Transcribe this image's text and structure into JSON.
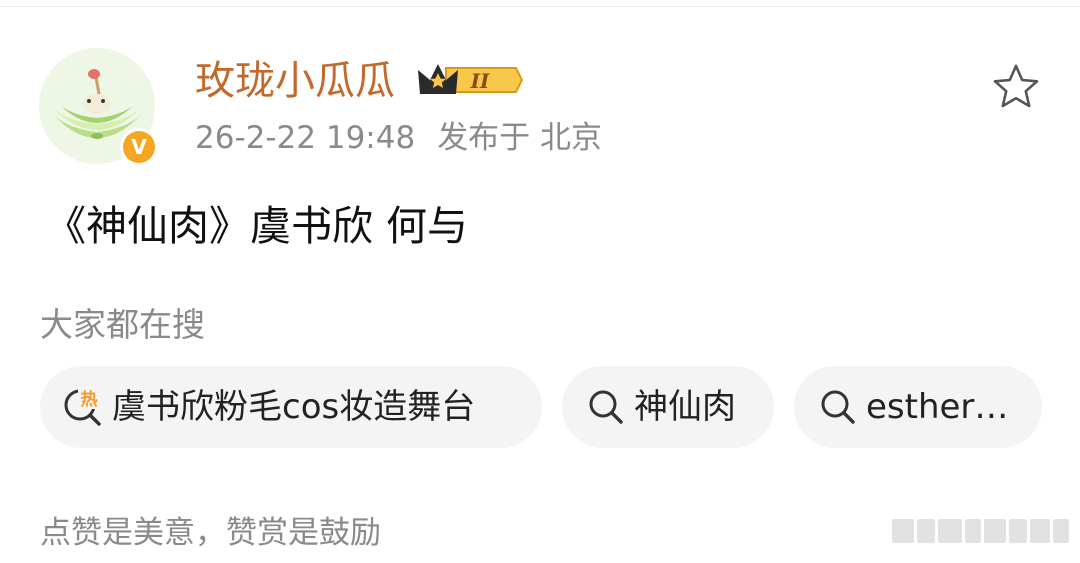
{
  "post": {
    "author": {
      "name": "玫珑小瓜瓜",
      "verified_badge": "V",
      "vip_level": "II",
      "avatar_icon": "melon-avatar-icon"
    },
    "timestamp": "26-2-22 19:48",
    "published_from": "发布于 北京",
    "favorite_icon": "star-outline-icon",
    "text": "《神仙肉》虞书欣 何与"
  },
  "trending": {
    "label": "大家都在搜",
    "chips": [
      {
        "label": "虞书欣粉毛cos妆造舞台",
        "icon": "hot-search-icon",
        "icon_text": "热"
      },
      {
        "label": "神仙肉",
        "icon": "search-icon"
      },
      {
        "label": "esther…",
        "icon": "search-icon"
      }
    ]
  },
  "footer": {
    "text": "点赞是美意，赞赏是鼓励"
  },
  "colors": {
    "author_name": "#c26a2d",
    "secondary_text": "#8a8a8a",
    "chip_bg": "#f4f4f4",
    "hot_icon": "#f39a2b",
    "verified": "#f5a623"
  }
}
